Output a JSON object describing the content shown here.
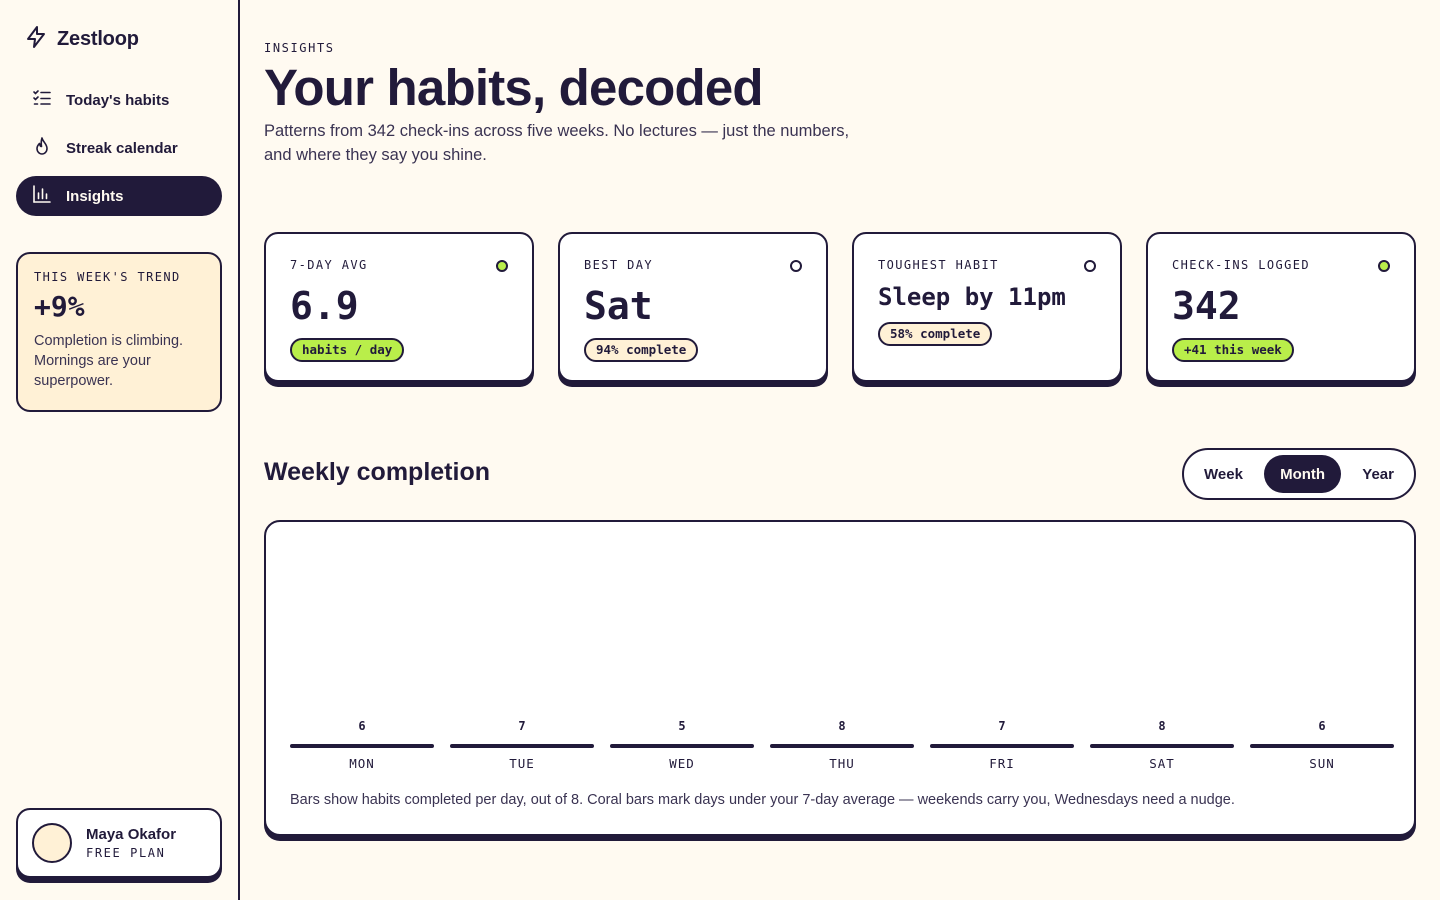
{
  "brand": {
    "name": "Zestloop",
    "icon": "bolt-icon"
  },
  "nav": [
    {
      "label": "Today's habits",
      "icon": "checklist-icon",
      "active": false
    },
    {
      "label": "Streak calendar",
      "icon": "flame-icon",
      "active": false
    },
    {
      "label": "Insights",
      "icon": "bar-chart-icon",
      "active": true
    }
  ],
  "trend": {
    "label": "THIS WEEK'S TREND",
    "value": "+9%",
    "text": "Completion is climbing. Mornings are your superpower."
  },
  "user": {
    "name": "Maya Okafor",
    "plan": "FREE PLAN"
  },
  "header": {
    "eyebrow": "INSIGHTS",
    "title": "Your habits, decoded",
    "subtitle": "Patterns from 342 check-ins across five weeks. No lectures — just the numbers, and where they say you shine."
  },
  "cards": [
    {
      "label": "7-DAY AVG",
      "value": "6.9",
      "pill": "habits / day",
      "pill_color": "#b9ee4a",
      "dot_color": "#b9ee4a"
    },
    {
      "label": "BEST DAY",
      "value": "Sat",
      "pill": "94% complete",
      "pill_color": "#fff1d6",
      "dot_color": "#ffffff"
    },
    {
      "label": "TOUGHEST HABIT",
      "value": "Sleep by 11pm",
      "pill": "58% complete",
      "pill_color": "#fff1d6",
      "dot_color": "#ffffff"
    },
    {
      "label": "CHECK-INS LOGGED",
      "value": "342",
      "pill": "+41 this week",
      "pill_color": "#b9ee4a",
      "dot_color": "#b9ee4a"
    }
  ],
  "section": {
    "title": "Weekly completion"
  },
  "range": {
    "options": [
      "Week",
      "Month",
      "Year"
    ],
    "selected": "Month"
  },
  "chart_note": "Bars show habits completed per day, out of 8. Coral bars mark days under your 7-day average — weekends carry you, Wednesdays need a nudge.",
  "colors": {
    "ink": "#211a3a",
    "lime": "#b9ee4a",
    "cream": "#fff1d6",
    "background": "#fffaf1"
  },
  "chart_data": {
    "type": "bar",
    "categories": [
      "MON",
      "TUE",
      "WED",
      "THU",
      "FRI",
      "SAT",
      "SUN"
    ],
    "values": [
      6,
      7,
      5,
      8,
      7,
      8,
      6
    ],
    "ylim": [
      0,
      8
    ],
    "grid": false
  }
}
